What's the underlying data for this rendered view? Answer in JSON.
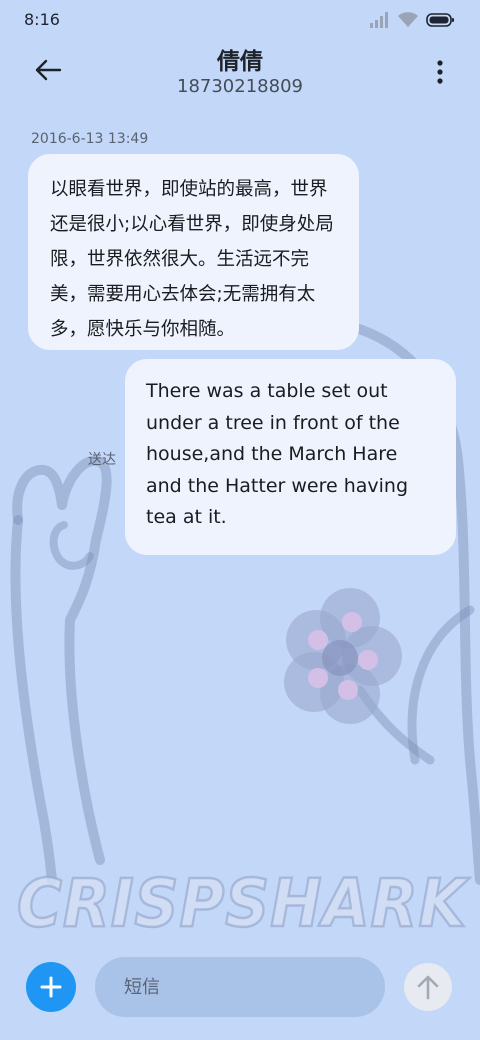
{
  "status_bar": {
    "time": "8:16",
    "icons": [
      "signal-icon",
      "wifi-icon",
      "battery-icon"
    ]
  },
  "header": {
    "contact_name": "倩倩",
    "contact_number": "18730218809",
    "back_icon": "back-arrow-icon",
    "more_icon": "more-vertical-icon"
  },
  "conversation": {
    "timestamp": "2016-6-13 13:49",
    "messages": [
      {
        "direction": "incoming",
        "text": "以眼看世界，即使站的最高，世界还是很小;以心看世界，即使身处局限，世界依然很大。生活远不完美，需要用心去体会;无需拥有太多，愿快乐与你相随。"
      },
      {
        "direction": "outgoing",
        "text": "There was a table set out under a tree in front of the house,and the March Hare and the Hatter were having tea at it.",
        "status": "送达"
      }
    ]
  },
  "composer": {
    "placeholder": "短信",
    "value": "",
    "add_icon": "plus-icon",
    "send_icon": "send-arrow-up-icon"
  },
  "wallpaper": {
    "watermark_text": "CRISPSHARK"
  },
  "colors": {
    "background": "#c3d8f8",
    "bubble": "#eef3fd",
    "accent": "#1f96f3",
    "input_background": "#a9c2e8"
  }
}
